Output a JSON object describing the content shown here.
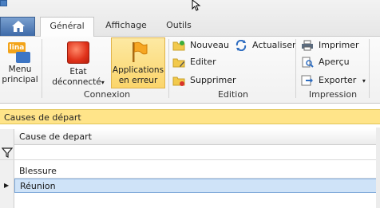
{
  "tabs": {
    "general": "Général",
    "affichage": "Affichage",
    "outils": "Outils"
  },
  "ribbon": {
    "menu_principal": {
      "line1": "Menu",
      "line2": "principal",
      "logo_text": "lina"
    },
    "etat": {
      "line1": "Etat",
      "line2": "déconnecté",
      "arrow": "▾"
    },
    "apps": {
      "line1": "Applications",
      "line2": "en erreur"
    },
    "connexion_label": "Connexion",
    "nouveau": "Nouveau",
    "editer": "Editer",
    "supprimer": "Supprimer",
    "actualiser": "Actualiser",
    "edition_label": "Edition",
    "imprimer": "Imprimer",
    "apercu": "Aperçu",
    "exporter": "Exporter",
    "exporter_arrow": "▾",
    "impression_label": "Impression"
  },
  "section": {
    "title": "Causes de départ"
  },
  "grid": {
    "column": "Cause de depart",
    "rows": [
      "Blessure",
      "Réunion"
    ],
    "selected_row_marker": "▶"
  },
  "colors": {
    "accent_yellow": "#ffe489",
    "selection": "#cfe3f8"
  }
}
